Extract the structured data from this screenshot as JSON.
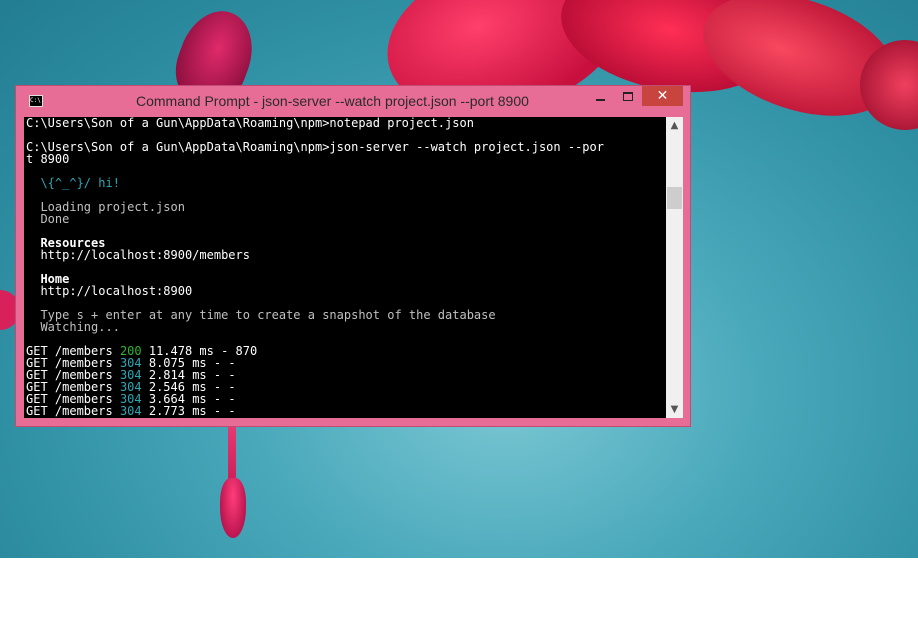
{
  "window": {
    "title": "Command Prompt - json-server  --watch project.json --port 8900",
    "icon": "cmd-icon",
    "icon_text": "C:\\.",
    "close_glyph": "✕",
    "up_glyph": "▲",
    "down_glyph": "▼"
  },
  "console": {
    "lines": [
      {
        "text": "C:\\Users\\Son of a Gun\\AppData\\Roaming\\npm>notepad project.json",
        "style": "white"
      },
      {
        "text": "",
        "style": "white"
      },
      {
        "text": "C:\\Users\\Son of a Gun\\AppData\\Roaming\\npm>json-server --watch project.json --por",
        "style": "white"
      },
      {
        "text": "t 8900",
        "style": "white"
      },
      {
        "text": "",
        "style": "white"
      },
      {
        "text": "  \\{^_^}/ hi!",
        "style": "cyan"
      },
      {
        "text": "",
        "style": "white"
      },
      {
        "text": "  Loading project.json",
        "style": "gray"
      },
      {
        "text": "  Done",
        "style": "gray"
      },
      {
        "text": "",
        "style": "white"
      },
      {
        "text": "  Resources",
        "style": "bold"
      },
      {
        "text": "  http://localhost:8900/members",
        "style": "white"
      },
      {
        "text": "",
        "style": "white"
      },
      {
        "text": "  Home",
        "style": "bold"
      },
      {
        "text": "  http://localhost:8900",
        "style": "white"
      },
      {
        "text": "",
        "style": "white"
      },
      {
        "text": "  Type s + enter at any time to create a snapshot of the database",
        "style": "gray"
      },
      {
        "text": "  Watching...",
        "style": "gray"
      },
      {
        "text": "",
        "style": "white"
      }
    ],
    "requests": [
      {
        "method": "GET",
        "path": "/members",
        "status": "200",
        "status_style": "green",
        "rest": "11.478 ms - 870"
      },
      {
        "method": "GET",
        "path": "/members",
        "status": "304",
        "status_style": "teal",
        "rest": "8.075 ms - -"
      },
      {
        "method": "GET",
        "path": "/members",
        "status": "304",
        "status_style": "teal",
        "rest": "2.814 ms - -"
      },
      {
        "method": "GET",
        "path": "/members",
        "status": "304",
        "status_style": "teal",
        "rest": "2.546 ms - -"
      },
      {
        "method": "GET",
        "path": "/members",
        "status": "304",
        "status_style": "teal",
        "rest": "3.664 ms - -"
      },
      {
        "method": "GET",
        "path": "/members",
        "status": "304",
        "status_style": "teal",
        "rest": "2.773 ms - -"
      }
    ]
  },
  "colors": {
    "titlebar": "#e86d96",
    "close_button": "#c7443f",
    "status_200": "#2fb52f",
    "status_304": "#2aa8b5"
  }
}
